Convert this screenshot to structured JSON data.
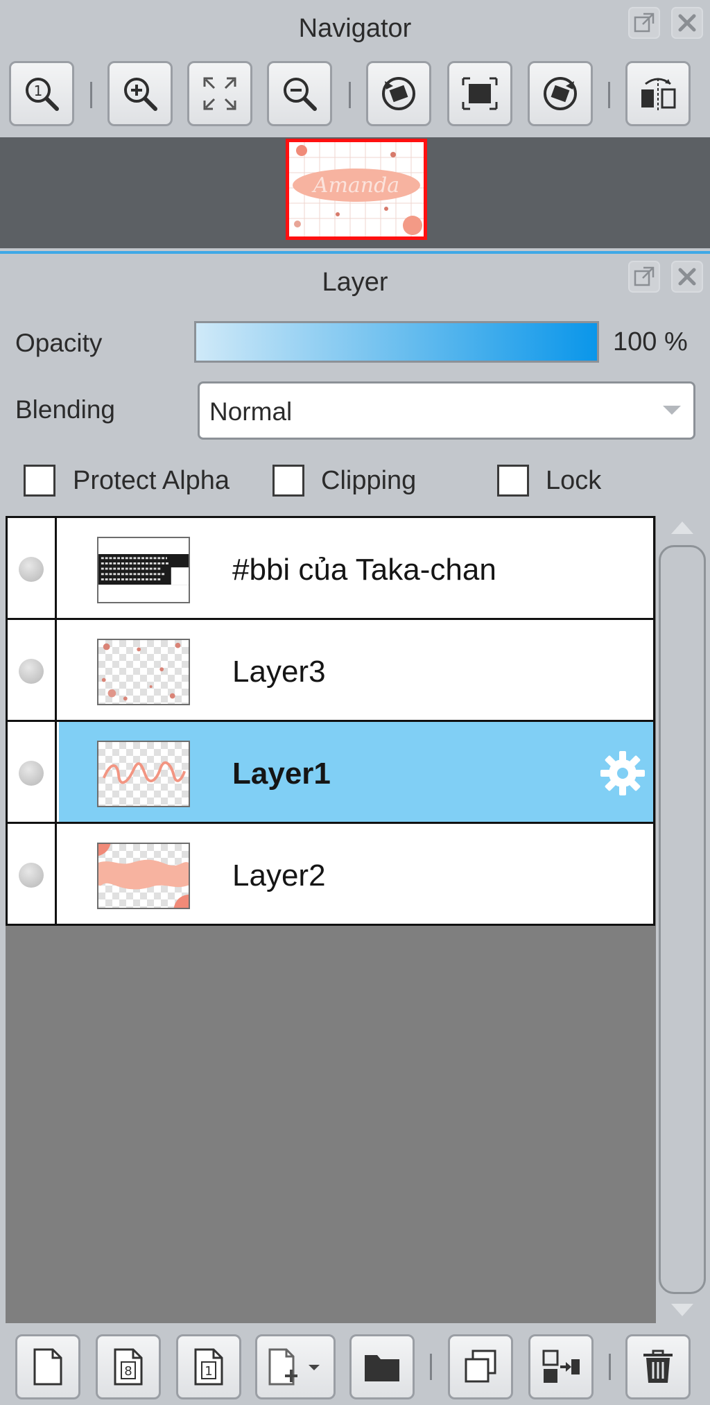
{
  "navigator": {
    "title": "Navigator",
    "toolbar": [
      {
        "name": "zoom-actual-icon"
      },
      {
        "name": "zoom-in-icon"
      },
      {
        "name": "fit-window-icon"
      },
      {
        "name": "zoom-out-icon"
      },
      {
        "name": "rotate-left-icon"
      },
      {
        "name": "reset-rotation-icon"
      },
      {
        "name": "rotate-right-icon"
      },
      {
        "name": "flip-horizontal-icon"
      }
    ],
    "preview_word": "Amanda"
  },
  "layer_panel": {
    "title": "Layer",
    "opacity_label": "Opacity",
    "opacity_value": "100 %",
    "opacity_fraction": 1.0,
    "blending_label": "Blending",
    "blending_value": "Normal",
    "checkboxes": {
      "protect_alpha": {
        "label": "Protect Alpha",
        "checked": false
      },
      "clipping": {
        "label": "Clipping",
        "checked": false
      },
      "lock": {
        "label": "Lock",
        "checked": false
      }
    },
    "layers": [
      {
        "name": "#bbi của Taka-chan",
        "selected": false,
        "thumb": "text-thumbnail"
      },
      {
        "name": "Layer3",
        "selected": false,
        "thumb": "sparse-sticker-thumbnail"
      },
      {
        "name": "Layer1",
        "selected": true,
        "thumb": "lettering-thumbnail"
      },
      {
        "name": "Layer2",
        "selected": false,
        "thumb": "peach-band-thumbnail"
      }
    ]
  },
  "bottom_toolbar": [
    {
      "name": "new-layer-icon"
    },
    {
      "name": "new-8bit-layer-icon"
    },
    {
      "name": "new-1bit-layer-icon"
    },
    {
      "name": "add-layer-menu-icon"
    },
    {
      "name": "new-folder-icon"
    },
    {
      "name": "duplicate-layer-icon"
    },
    {
      "name": "merge-down-icon"
    },
    {
      "name": "delete-layer-icon"
    }
  ],
  "colors": {
    "selection": "#80cff5",
    "accent_line": "#3fa8e6",
    "navigator_frame": "#ff1010",
    "peach": "#f7b3a0"
  }
}
